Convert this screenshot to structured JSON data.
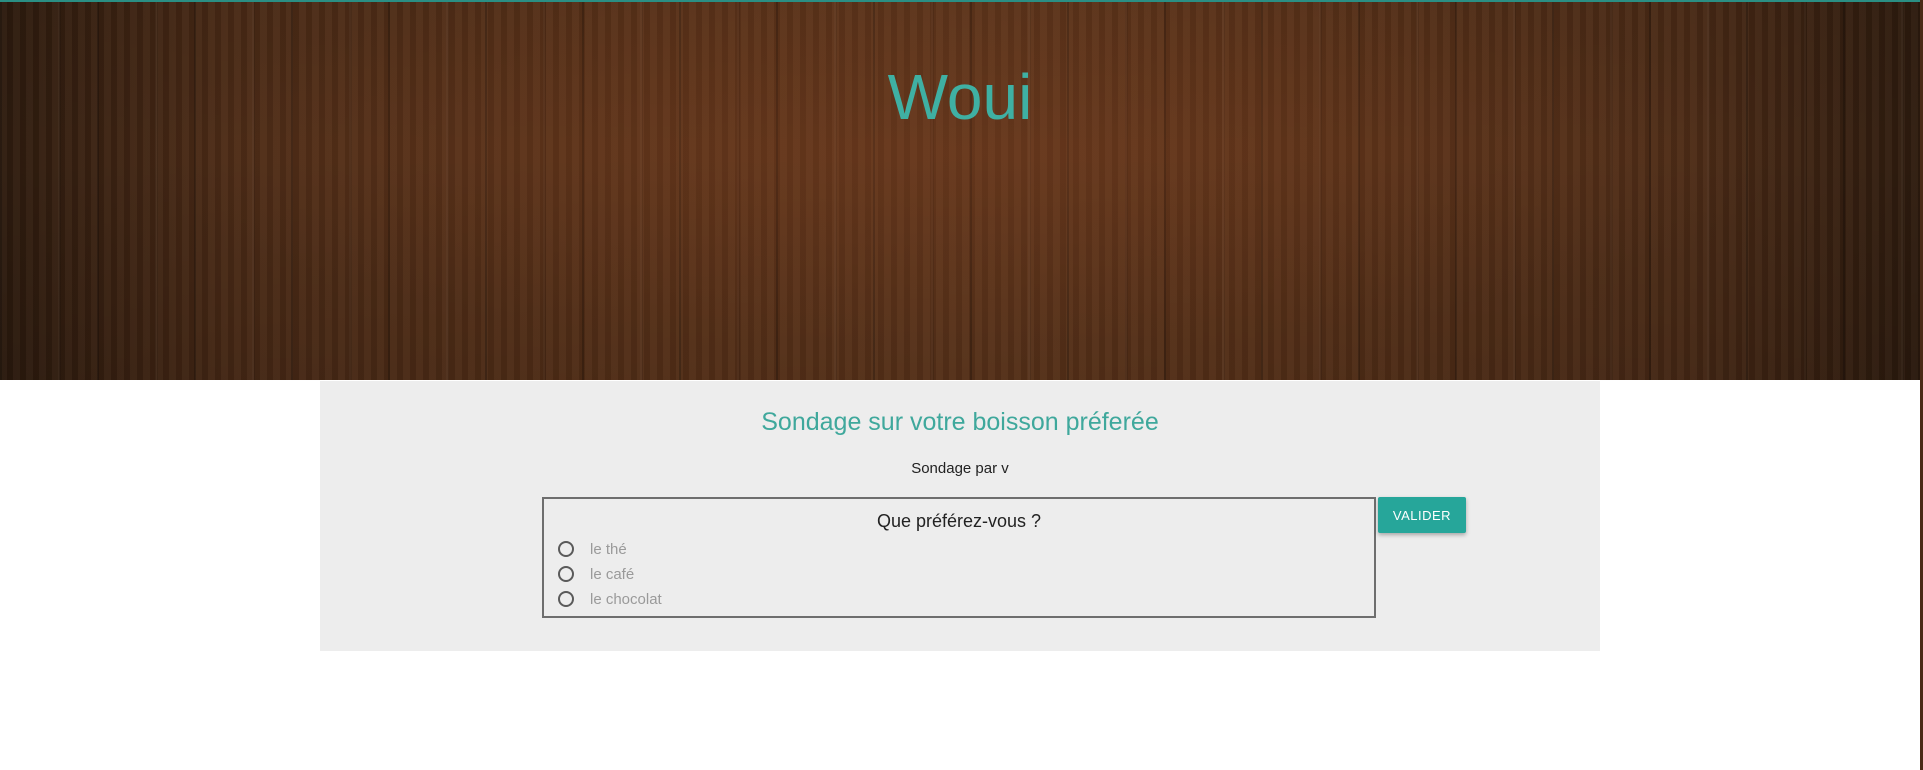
{
  "header": {
    "site_title": "Woui"
  },
  "poll": {
    "title": "Sondage sur votre boisson préferée",
    "author": "Sondage par v",
    "question": "Que préférez-vous ?",
    "options": [
      {
        "label": "le thé",
        "selected": false
      },
      {
        "label": "le café",
        "selected": false
      },
      {
        "label": "le chocolat",
        "selected": false
      }
    ],
    "submit_label": "VALIDER"
  },
  "colors": {
    "accent": "#26a69a",
    "title_teal": "#3fb0a3",
    "panel_bg": "#ededed",
    "wood_dark": "#2c1a0e",
    "wood_mid": "#5a3219"
  }
}
